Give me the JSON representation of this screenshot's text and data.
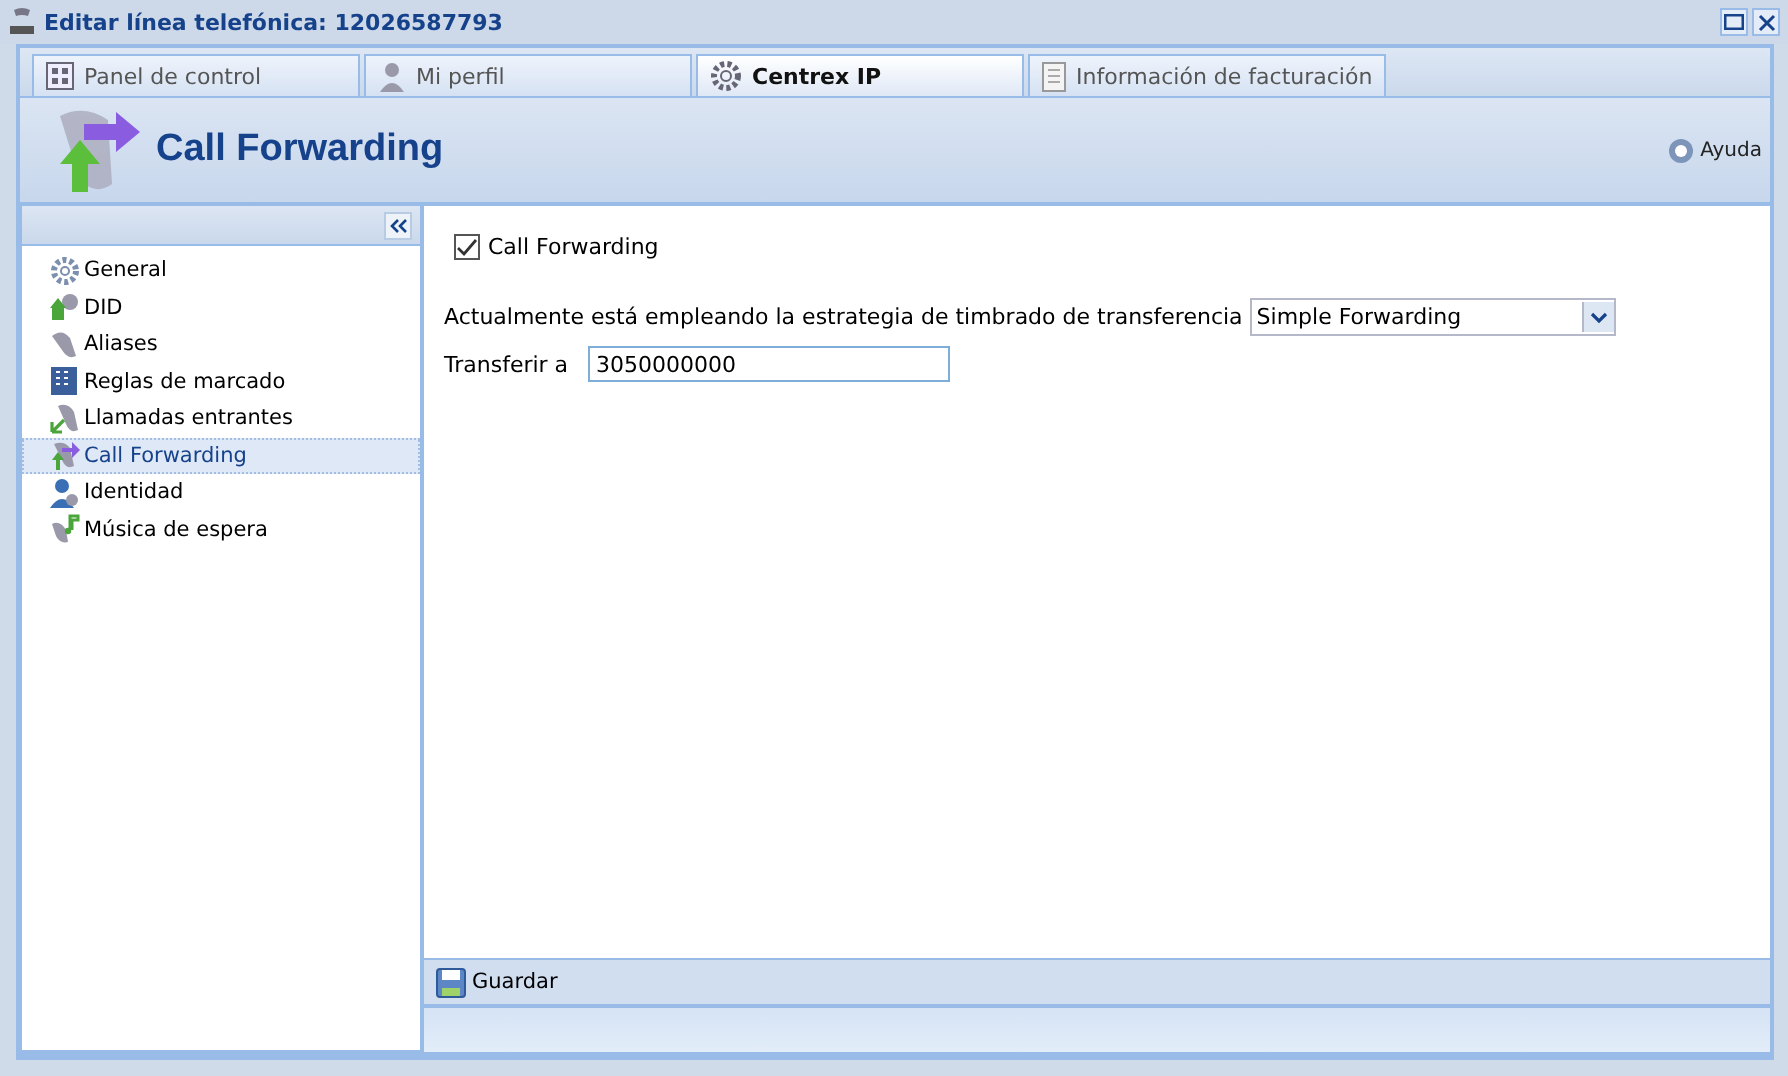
{
  "window": {
    "title": "Editar línea telefónica: 12026587793"
  },
  "tabs": [
    {
      "label": "Panel de control",
      "kind": "panel",
      "selected": false
    },
    {
      "label": "Mi perfil",
      "kind": "person",
      "selected": false
    },
    {
      "label": "Centrex IP",
      "kind": "gear",
      "selected": true
    },
    {
      "label": "Información de facturación",
      "kind": "document",
      "selected": false
    }
  ],
  "header": {
    "title": "Call Forwarding",
    "help": "Ayuda"
  },
  "sidebar": {
    "items": [
      {
        "label": "General",
        "kind": "gear",
        "selected": false
      },
      {
        "label": "DID",
        "kind": "did",
        "selected": false
      },
      {
        "label": "Aliases",
        "kind": "phone",
        "selected": false
      },
      {
        "label": "Reglas de marcado",
        "kind": "keypad",
        "selected": false
      },
      {
        "label": "Llamadas entrantes",
        "kind": "incoming",
        "selected": false
      },
      {
        "label": "Call Forwarding",
        "kind": "forward",
        "selected": true
      },
      {
        "label": "Identidad",
        "kind": "person",
        "selected": false
      },
      {
        "label": "Música de espera",
        "kind": "music",
        "selected": false
      }
    ]
  },
  "form": {
    "checkbox": {
      "label": "Call Forwarding",
      "checked": true
    },
    "strategy": {
      "label": "Actualmente está empleando la estrategia de timbrado de transferencia",
      "value": "Simple Forwarding"
    },
    "transfer": {
      "label": "Transferir a",
      "value": "3050000000"
    }
  },
  "toolbar": {
    "save": "Guardar"
  }
}
